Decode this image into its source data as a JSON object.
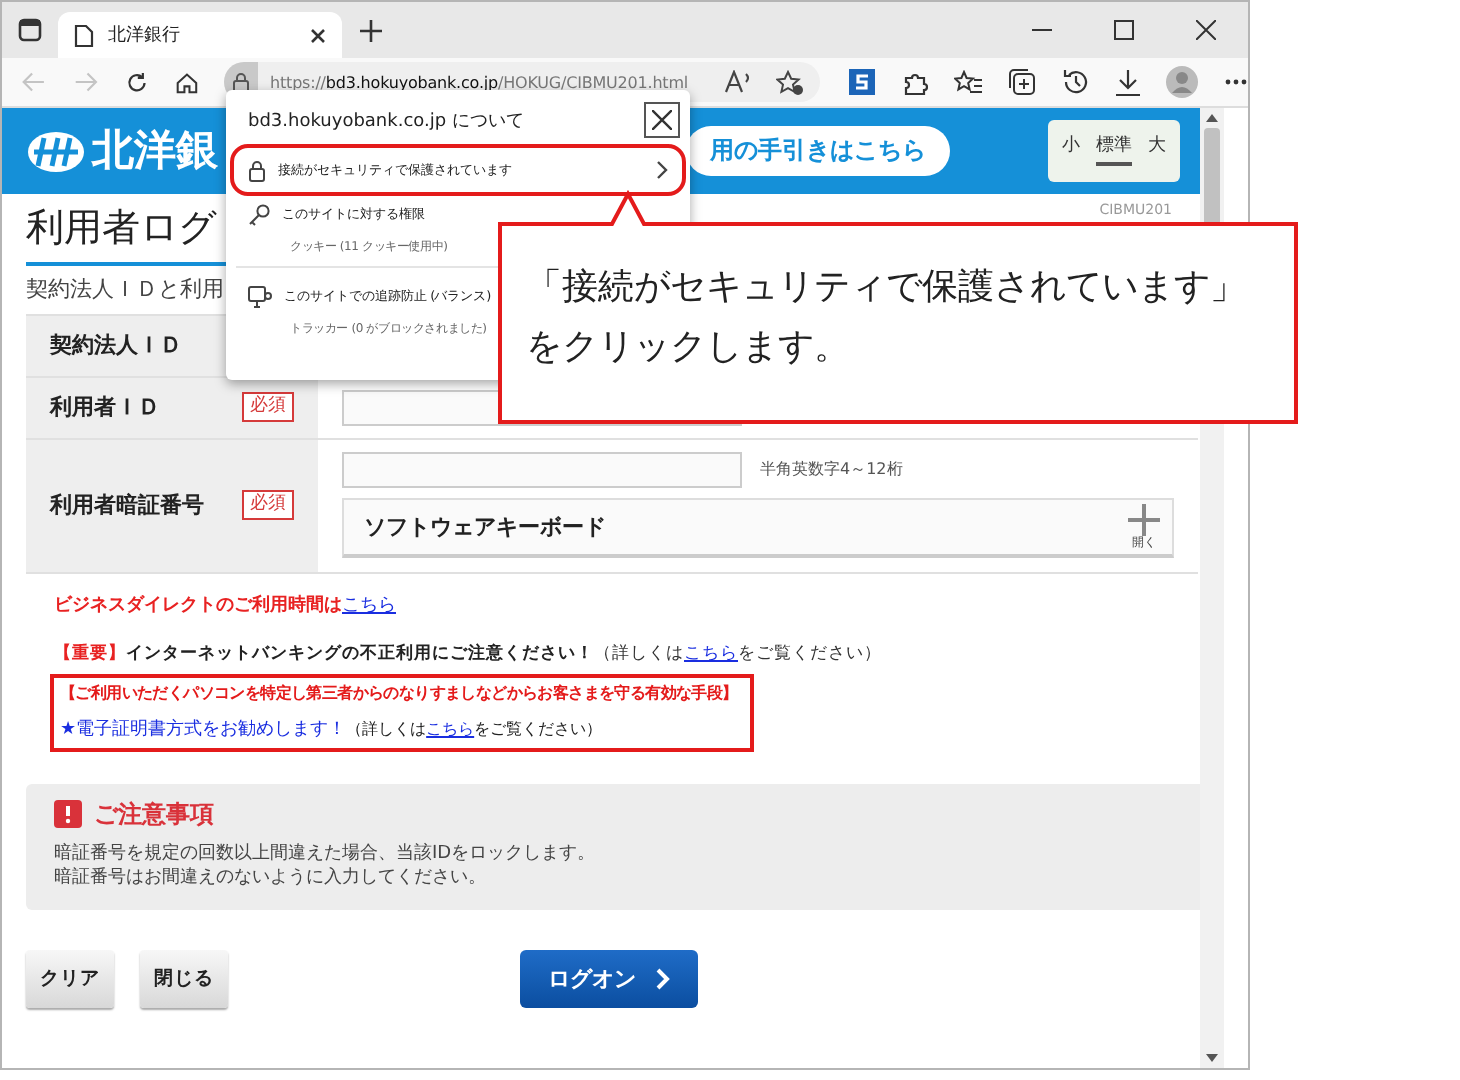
{
  "browser": {
    "tab_title": "北洋銀行",
    "url_scheme": "https://",
    "url_host": "bd3.hokuyobank.co.jp",
    "url_path": "/HOKUG/CIBMU201.html",
    "nav": [
      {
        "kind": "back",
        "disabled": true
      },
      {
        "kind": "forward",
        "disabled": true
      },
      {
        "kind": "refresh",
        "disabled": false
      },
      {
        "kind": "home",
        "disabled": false
      }
    ]
  },
  "header": {
    "logo_text": "北洋銀",
    "guide_link": "用の手引きはこちら",
    "font_sizes": [
      {
        "label": "小",
        "selected": false
      },
      {
        "label": "標準",
        "selected": true
      },
      {
        "label": "大",
        "selected": false
      }
    ]
  },
  "page": {
    "title": "利用者ログ",
    "screen_id": "CIBMU201",
    "intro": "契約法人ＩＤと利用"
  },
  "form": {
    "rows": [
      {
        "label": "契約法人ＩＤ",
        "kind": "covered"
      },
      {
        "label": "利用者ＩＤ",
        "badge": "必須",
        "kind": "input"
      },
      {
        "label": "利用者暗証番号",
        "badge": "必須",
        "kind": "password",
        "hint": "半角英数字4～12桁",
        "keyboard": {
          "label": "ソフトウェアキーボード",
          "toggle": "開く",
          "expanded": false
        }
      }
    ]
  },
  "notes": {
    "hours": {
      "text": "ビジネスダイレクトのご利用時間は",
      "link": "こちら"
    },
    "warning": {
      "tag": "【重要】",
      "headline": "インターネットバンキングの不正利用にご注意ください！",
      "before": "（詳しくは",
      "link": "こちら",
      "after": "をご覧ください）"
    },
    "boxed": {
      "heading": "【ご利用いただくパソコンを特定し第三者からのなりすましなどからお客さまを守る有効な手段】",
      "lead": "★電子証明書方式をお勧めします！",
      "before": "（詳しくは",
      "link": "こちら",
      "after": "をご覧ください）"
    }
  },
  "caution": {
    "title": "ご注意事項",
    "lines": [
      "暗証番号を規定の回数以上間違えた場合、当該IDをロックします。",
      "暗証番号はお間違えのないように入力してください。"
    ]
  },
  "buttons": [
    {
      "label": "クリア",
      "kind": "secondary"
    },
    {
      "label": "閉じる",
      "kind": "secondary"
    },
    {
      "label": "ログオン",
      "kind": "primary"
    }
  ],
  "popup": {
    "title": "bd3.hokuyobank.co.jp について",
    "items": [
      {
        "kind": "security",
        "label": "接続がセキュリティで保護されています",
        "highlighted": true
      },
      {
        "kind": "permissions",
        "label": "このサイトに対する権限",
        "highlighted": false
      },
      {
        "kind": "detail",
        "label": "クッキー (11 クッキー使用中)"
      },
      {
        "kind": "divider"
      },
      {
        "kind": "tracking",
        "label": "このサイトでの追跡防止 (バランス)",
        "highlighted": false
      },
      {
        "kind": "detail",
        "label": "トラッカー (0 がブロックされました)"
      }
    ]
  },
  "callout": {
    "text": "「接続がセキュリティで保護されています」をクリックします。"
  }
}
